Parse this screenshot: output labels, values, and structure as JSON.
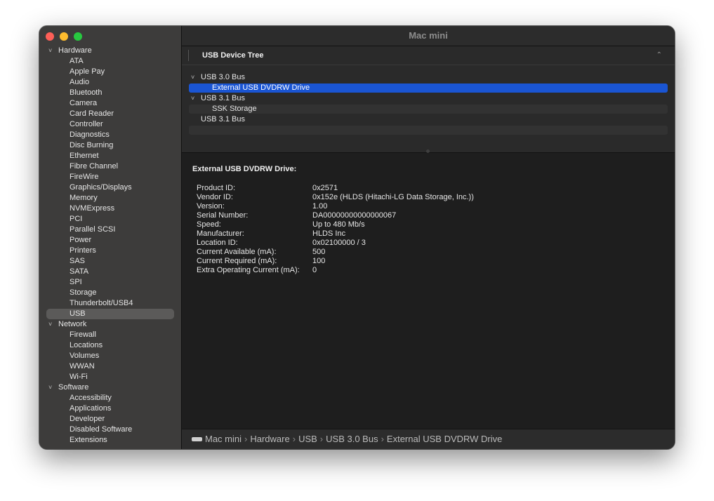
{
  "window": {
    "title": "Mac mini"
  },
  "sidebar": {
    "groups": [
      {
        "label": "Hardware",
        "items": [
          "ATA",
          "Apple Pay",
          "Audio",
          "Bluetooth",
          "Camera",
          "Card Reader",
          "Controller",
          "Diagnostics",
          "Disc Burning",
          "Ethernet",
          "Fibre Channel",
          "FireWire",
          "Graphics/Displays",
          "Memory",
          "NVMExpress",
          "PCI",
          "Parallel SCSI",
          "Power",
          "Printers",
          "SAS",
          "SATA",
          "SPI",
          "Storage",
          "Thunderbolt/USB4",
          "USB"
        ]
      },
      {
        "label": "Network",
        "items": [
          "Firewall",
          "Locations",
          "Volumes",
          "WWAN",
          "Wi-Fi"
        ]
      },
      {
        "label": "Software",
        "items": [
          "Accessibility",
          "Applications",
          "Developer",
          "Disabled Software",
          "Extensions"
        ]
      }
    ],
    "selected": "USB"
  },
  "section": {
    "title": "USB Device Tree",
    "collapse_icon": "chevron-up-icon"
  },
  "device_tree": [
    {
      "label": "USB 3.0 Bus",
      "expandable": true,
      "indent": 0
    },
    {
      "label": "External USB DVDRW Drive",
      "expandable": false,
      "indent": 1,
      "selected": true
    },
    {
      "label": "USB 3.1 Bus",
      "expandable": true,
      "indent": 0
    },
    {
      "label": "SSK Storage",
      "expandable": false,
      "indent": 1
    },
    {
      "label": "USB 3.1 Bus",
      "expandable": false,
      "indent": 0
    }
  ],
  "details": {
    "title": "External USB DVDRW Drive:",
    "properties": [
      {
        "key": "Product ID:",
        "value": "0x2571"
      },
      {
        "key": "Vendor ID:",
        "value": "0x152e  (HLDS (Hitachi-LG Data Storage, Inc.))"
      },
      {
        "key": "Version:",
        "value": "1.00"
      },
      {
        "key": "Serial Number:",
        "value": "DA00000000000000067"
      },
      {
        "key": "Speed:",
        "value": "Up to 480 Mb/s"
      },
      {
        "key": "Manufacturer:",
        "value": "HLDS Inc"
      },
      {
        "key": "Location ID:",
        "value": "0x02100000 / 3"
      },
      {
        "key": "Current Available (mA):",
        "value": "500"
      },
      {
        "key": "Current Required (mA):",
        "value": "100"
      },
      {
        "key": "Extra Operating Current (mA):",
        "value": "0"
      }
    ]
  },
  "path_bar": [
    "Mac mini",
    "Hardware",
    "USB",
    "USB 3.0 Bus",
    "External USB DVDRW Drive"
  ],
  "colors": {
    "selection": "#1a55d3",
    "sidebar_bg": "#3d3c3b",
    "content_bg": "#1e1e1e"
  }
}
